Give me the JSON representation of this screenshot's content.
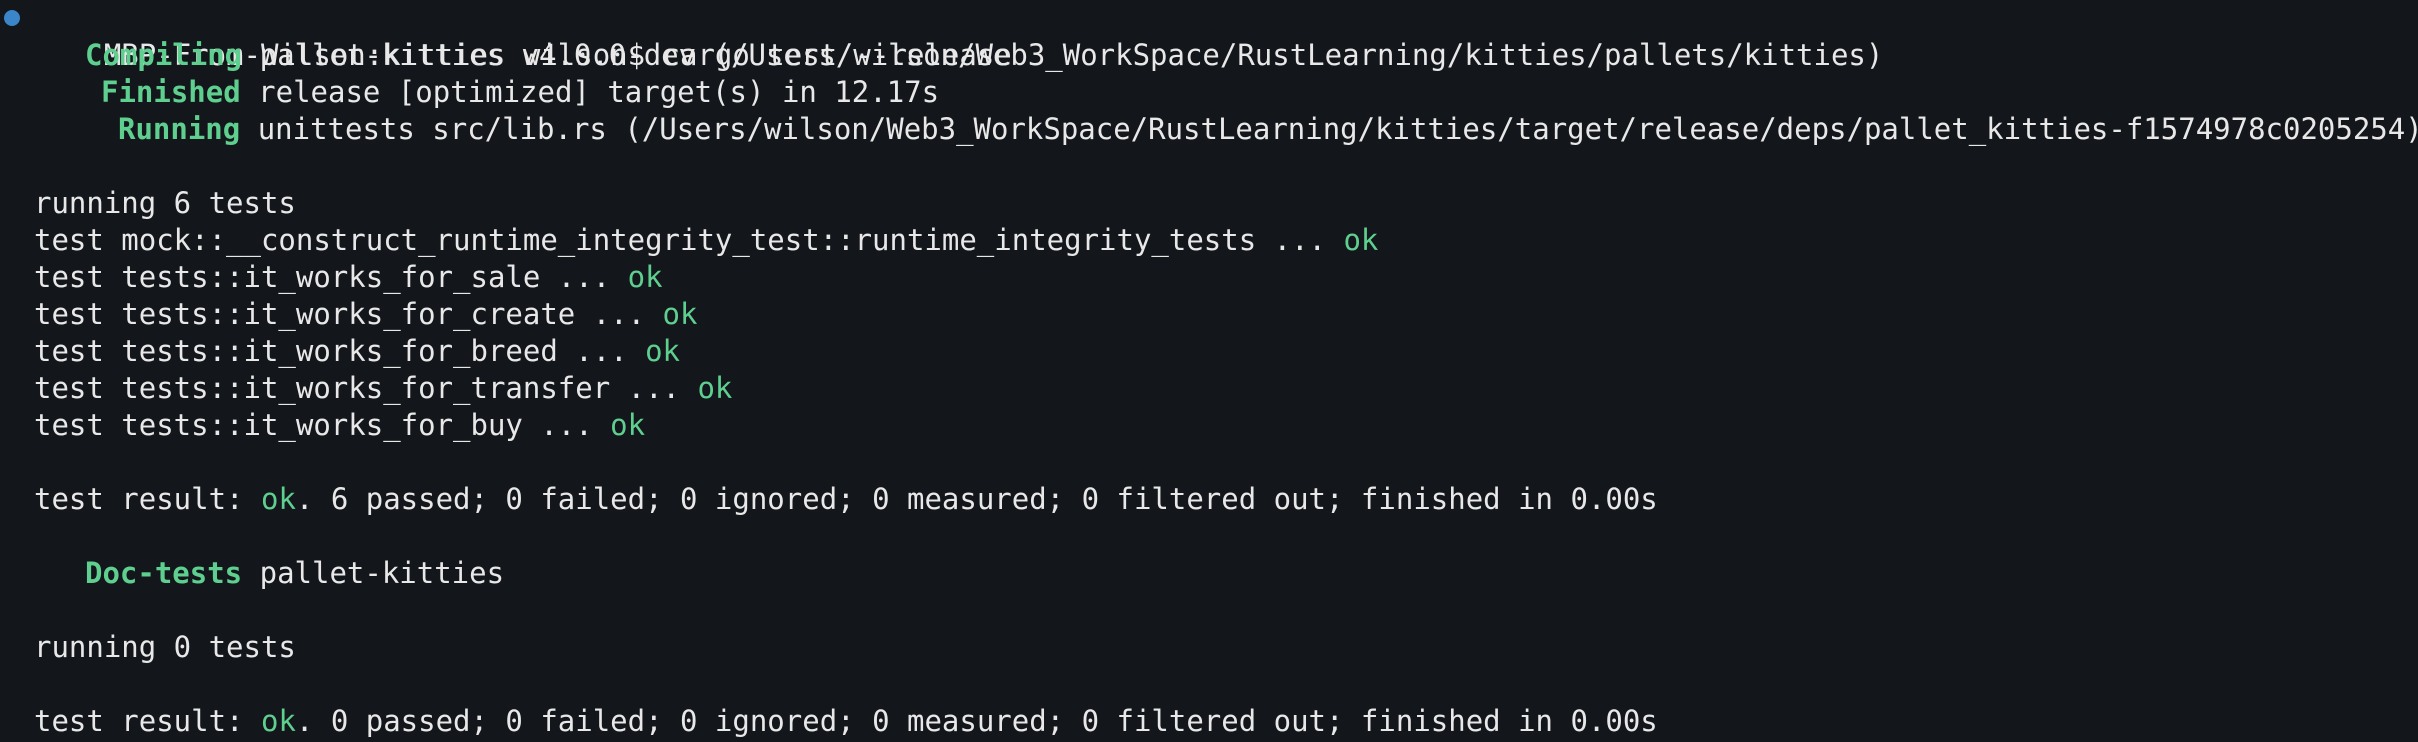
{
  "prompt": {
    "text": "MBP-From-Wilson:kitties wilson$ cargo test --release"
  },
  "cargo": {
    "compiling": {
      "label": "Compiling",
      "text": "pallet-kitties v4.0.0-dev (/Users/wilson/Web3_WorkSpace/RustLearning/kitties/pallets/kitties)"
    },
    "finished": {
      "label": "Finished",
      "text": "release [optimized] target(s) in 12.17s"
    },
    "running": {
      "label": "Running",
      "text": "unittests src/lib.rs (/Users/wilson/Web3_WorkSpace/RustLearning/kitties/target/release/deps/pallet_kitties-f1574978c0205254)"
    }
  },
  "unit_tests": {
    "header": "running 6 tests",
    "tests": [
      {
        "name": "test mock::__construct_runtime_integrity_test::runtime_integrity_tests ... ",
        "status": "ok"
      },
      {
        "name": "test tests::it_works_for_sale ... ",
        "status": "ok"
      },
      {
        "name": "test tests::it_works_for_create ... ",
        "status": "ok"
      },
      {
        "name": "test tests::it_works_for_breed ... ",
        "status": "ok"
      },
      {
        "name": "test tests::it_works_for_transfer ... ",
        "status": "ok"
      },
      {
        "name": "test tests::it_works_for_buy ... ",
        "status": "ok"
      }
    ],
    "result": {
      "prefix": "test result: ",
      "status": "ok",
      "suffix": ". 6 passed; 0 failed; 0 ignored; 0 measured; 0 filtered out; finished in 0.00s"
    }
  },
  "doc_tests": {
    "label": "Doc-tests",
    "text": "pallet-kitties",
    "header": "running 0 tests",
    "result": {
      "prefix": "test result: ",
      "status": "ok",
      "suffix": ". 0 passed; 0 failed; 0 ignored; 0 measured; 0 filtered out; finished in 0.00s"
    }
  },
  "colors": {
    "background": "#13161b",
    "text": "#e8e8e8",
    "accent_green": "#5fcf8f",
    "status_dot": "#3a86c8"
  }
}
